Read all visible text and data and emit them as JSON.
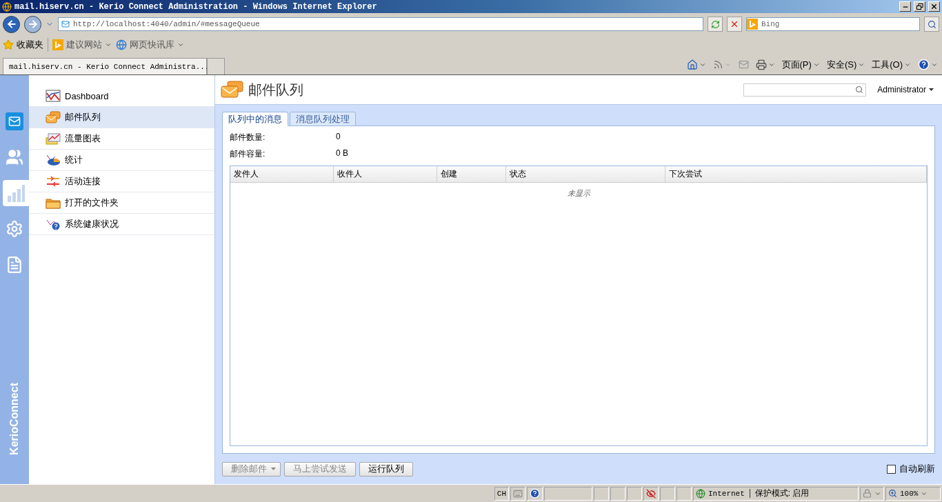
{
  "browser": {
    "title": "mail.hiserv.cn - Kerio Connect Administration - Windows Internet Explorer",
    "address": "http://localhost:4040/admin/#messageQueue",
    "search_placeholder": "Bing",
    "favorites": [
      {
        "kind": "star",
        "label": "收藏夹",
        "dropdown": false
      },
      {
        "kind": "bing",
        "label": "建议网站",
        "dropdown": true
      },
      {
        "kind": "ie",
        "label": "网页快讯库",
        "dropdown": true
      }
    ],
    "tabs": [
      {
        "label": "mail.hiserv.cn - Kerio Connect Administra...",
        "selected": true
      }
    ],
    "commands": [
      {
        "kind": "home"
      },
      {
        "kind": "rss"
      },
      {
        "kind": "mail"
      },
      {
        "kind": "print"
      },
      {
        "kind": "text",
        "label": "页面(P)"
      },
      {
        "kind": "text",
        "label": "安全(S)"
      },
      {
        "kind": "text",
        "label": "工具(O)"
      },
      {
        "kind": "help"
      }
    ]
  },
  "rail": {
    "items": [
      {
        "kind": "mail",
        "selected": false
      },
      {
        "kind": "users",
        "selected": false
      },
      {
        "kind": "stats",
        "selected": true
      },
      {
        "kind": "settings",
        "selected": false
      },
      {
        "kind": "logs",
        "selected": false
      }
    ],
    "brand": "KerioConnect"
  },
  "nav": {
    "items": [
      {
        "kind": "dashboard",
        "label": "Dashboard",
        "selected": false
      },
      {
        "kind": "queue",
        "label": "邮件队列",
        "selected": true
      },
      {
        "kind": "traffic",
        "label": "流量图表",
        "selected": false
      },
      {
        "kind": "statistics",
        "label": "统计",
        "selected": false
      },
      {
        "kind": "connections",
        "label": "活动连接",
        "selected": false
      },
      {
        "kind": "folder",
        "label": "打开的文件夹",
        "selected": false
      },
      {
        "kind": "health",
        "label": "系统健康状况",
        "selected": false
      }
    ]
  },
  "page": {
    "title": "邮件队列",
    "user": "Administrator",
    "tabs": [
      {
        "label": "队列中的消息",
        "selected": true
      },
      {
        "label": "消息队列处理",
        "selected": false
      }
    ],
    "summary": [
      {
        "label": "邮件数量:",
        "value": "0"
      },
      {
        "label": "邮件容量:",
        "value": "0 B"
      }
    ],
    "table": {
      "columns": [
        "发件人",
        "收件人",
        "创建",
        "状态",
        "下次尝试"
      ],
      "empty_text": "未显示"
    },
    "buttons": [
      {
        "label": "删除邮件",
        "disabled": true,
        "dropdown": true
      },
      {
        "label": "马上尝试发送",
        "disabled": true,
        "dropdown": false
      },
      {
        "label": "运行队列",
        "disabled": false,
        "dropdown": false
      }
    ],
    "auto_refresh": {
      "label": "自动刷新",
      "checked": false
    }
  },
  "status_bar": {
    "input": "CH",
    "zone": "Internet",
    "mode": "保护模式: 启用",
    "zoom": "100%"
  }
}
